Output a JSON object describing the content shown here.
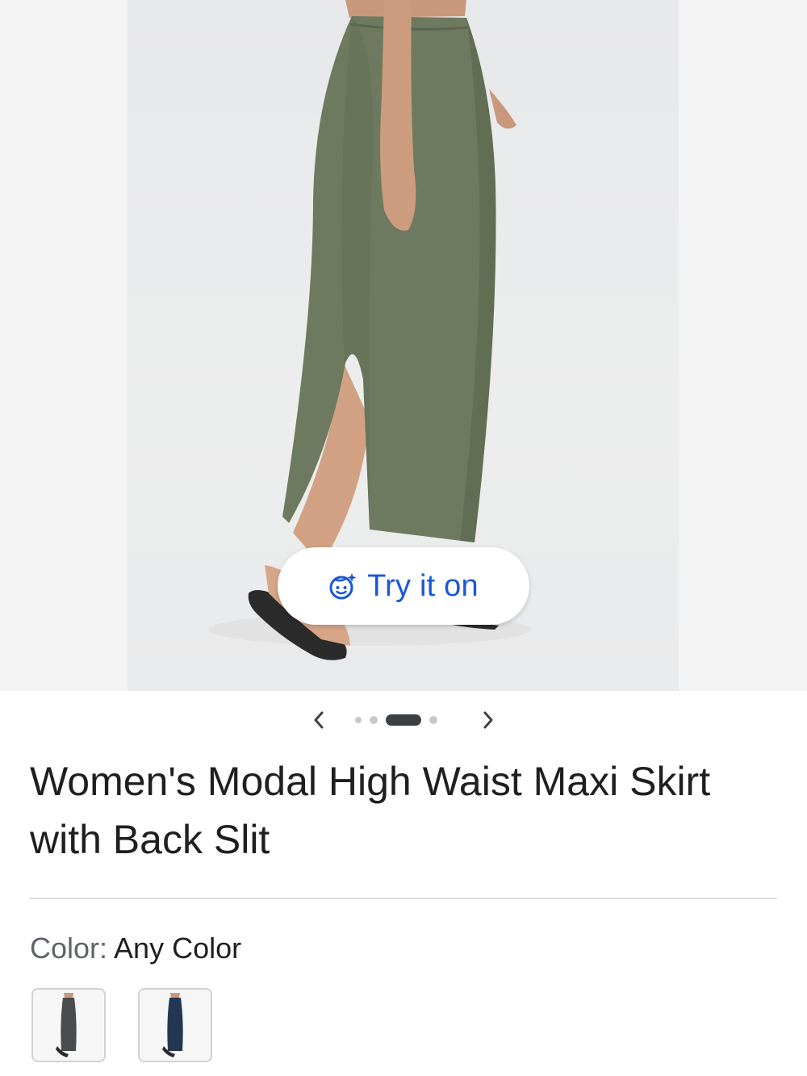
{
  "hero": {
    "try_on_label": "Try it on",
    "try_on_icon": "face-sparkle-icon",
    "accent": "#1a57d8"
  },
  "carousel": {
    "prev_icon": "chevron-left-icon",
    "next_icon": "chevron-right-icon",
    "image_count": 5,
    "active_index": 2
  },
  "product": {
    "title": "Women's Modal High Waist Maxi Skirt with Back Slit"
  },
  "color": {
    "label": "Color:",
    "value": "Any Color",
    "swatches": [
      {
        "name": "dark-gray",
        "color": "#4a4b4d"
      },
      {
        "name": "navy",
        "color": "#243752"
      }
    ]
  },
  "colors": {
    "skirt": "#6d7a5f",
    "background": "#f3f3f3"
  }
}
